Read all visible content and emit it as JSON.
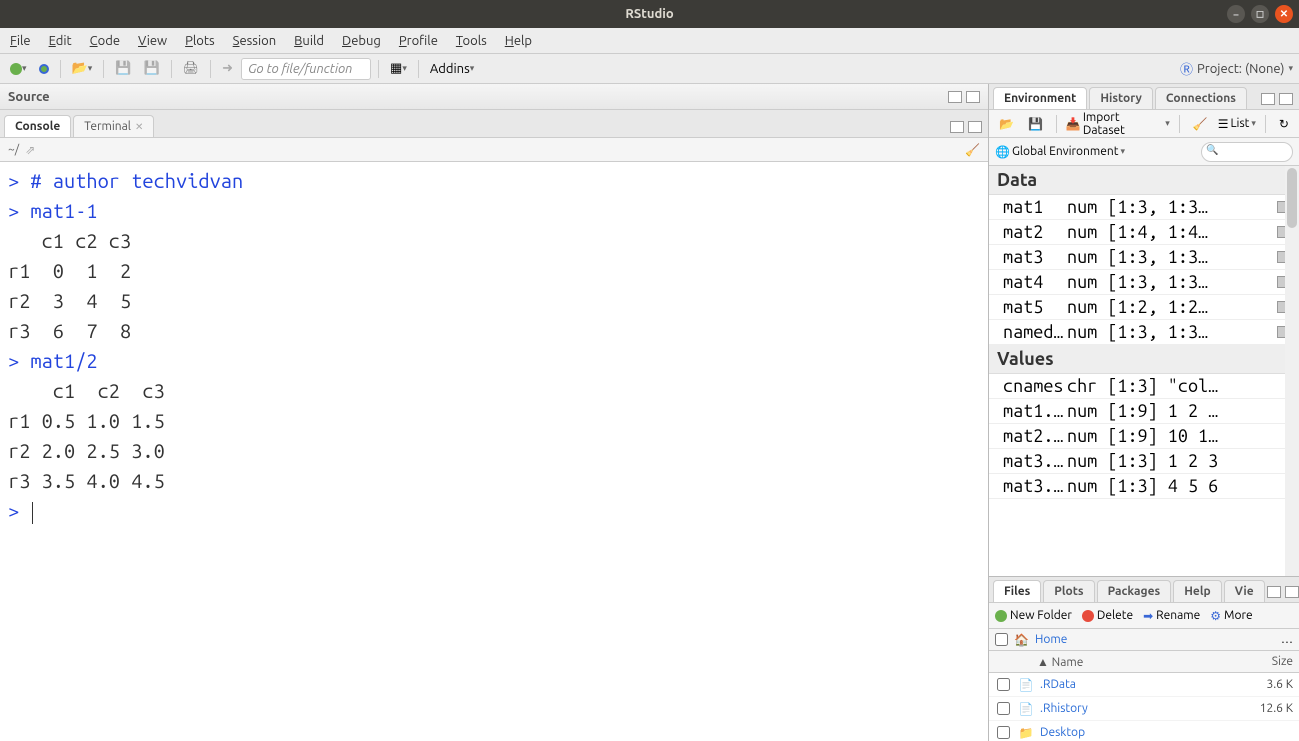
{
  "window": {
    "title": "RStudio"
  },
  "menu": [
    "File",
    "Edit",
    "Code",
    "View",
    "Plots",
    "Session",
    "Build",
    "Debug",
    "Profile",
    "Tools",
    "Help"
  ],
  "toolbar": {
    "goto_placeholder": "Go to file/function",
    "addins": "Addins",
    "project_label": "Project: (None)"
  },
  "source": {
    "title": "Source"
  },
  "console": {
    "tabs": [
      "Console",
      "Terminal"
    ],
    "path": "~/",
    "lines": [
      {
        "t": "prompt",
        "text": "> "
      },
      {
        "t": "comment",
        "text": "# author techvidvan"
      },
      {
        "t": "nl"
      },
      {
        "t": "prompt",
        "text": "> "
      },
      {
        "t": "code",
        "text": "mat1-1"
      },
      {
        "t": "nl"
      },
      {
        "t": "out",
        "text": "   c1 c2 c3"
      },
      {
        "t": "nl"
      },
      {
        "t": "out",
        "text": "r1  0  1  2"
      },
      {
        "t": "nl"
      },
      {
        "t": "out",
        "text": "r2  3  4  5"
      },
      {
        "t": "nl"
      },
      {
        "t": "out",
        "text": "r3  6  7  8"
      },
      {
        "t": "nl"
      },
      {
        "t": "prompt",
        "text": "> "
      },
      {
        "t": "code",
        "text": "mat1/2"
      },
      {
        "t": "nl"
      },
      {
        "t": "out",
        "text": "    c1  c2  c3"
      },
      {
        "t": "nl"
      },
      {
        "t": "out",
        "text": "r1 0.5 1.0 1.5"
      },
      {
        "t": "nl"
      },
      {
        "t": "out",
        "text": "r2 2.0 2.5 3.0"
      },
      {
        "t": "nl"
      },
      {
        "t": "out",
        "text": "r3 3.5 4.0 4.5"
      },
      {
        "t": "nl"
      },
      {
        "t": "prompt",
        "text": "> "
      },
      {
        "t": "cursor"
      }
    ]
  },
  "environment": {
    "tabs": [
      "Environment",
      "History",
      "Connections"
    ],
    "import_label": "Import Dataset",
    "list_label": "List",
    "scope_label": "Global Environment",
    "sections": [
      {
        "title": "Data",
        "items": [
          {
            "name": "mat1",
            "value": "num [1:3, 1:3…",
            "grid": true
          },
          {
            "name": "mat2",
            "value": "num [1:4, 1:4…",
            "grid": true
          },
          {
            "name": "mat3",
            "value": "num [1:3, 1:3…",
            "grid": true
          },
          {
            "name": "mat4",
            "value": "num [1:3, 1:3…",
            "grid": true
          },
          {
            "name": "mat5",
            "value": "num [1:2, 1:2…",
            "grid": true
          },
          {
            "name": "named…",
            "value": "num [1:3, 1:3…",
            "grid": true
          }
        ]
      },
      {
        "title": "Values",
        "items": [
          {
            "name": "cnames",
            "value": "chr [1:3] \"col…",
            "grid": false
          },
          {
            "name": "mat1.…",
            "value": "num [1:9] 1 2 …",
            "grid": false
          },
          {
            "name": "mat2.…",
            "value": "num [1:9] 10 1…",
            "grid": false
          },
          {
            "name": "mat3.…",
            "value": "num [1:3] 1 2 3",
            "grid": false
          },
          {
            "name": "mat3.…",
            "value": "num [1:3] 4 5 6",
            "grid": false
          }
        ]
      }
    ]
  },
  "files": {
    "tabs": [
      "Files",
      "Plots",
      "Packages",
      "Help",
      "Vie"
    ],
    "toolbar": {
      "new_folder": "New Folder",
      "delete": "Delete",
      "rename": "Rename",
      "more": "More"
    },
    "path": {
      "home": "Home"
    },
    "columns": {
      "name": "Name",
      "size": "Size"
    },
    "rows": [
      {
        "icon": "rdata",
        "name": ".RData",
        "size": "3.6 K"
      },
      {
        "icon": "rhistory",
        "name": ".Rhistory",
        "size": "12.6 K"
      },
      {
        "icon": "folder",
        "name": "Desktop",
        "size": ""
      }
    ]
  }
}
